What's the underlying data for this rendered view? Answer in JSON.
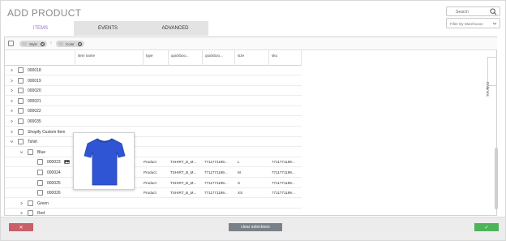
{
  "title": "ADD PRODUCT",
  "tabs": [
    {
      "label": "ITEMS",
      "active": true
    },
    {
      "label": "EVENTS",
      "active": false
    },
    {
      "label": "ADVANCED",
      "active": false
    }
  ],
  "search": {
    "placeholder": "Search",
    "icon": "search-icon"
  },
  "filter": {
    "placeholder": "Filter By Warehouse",
    "icon": "chevron-down-icon"
  },
  "group_by": [
    {
      "label": "Style"
    },
    {
      "label": "Color"
    }
  ],
  "columns_panel_label": "Columns",
  "columns": [
    "",
    "item name",
    "type",
    "quickboo...",
    "quickboo...",
    "size",
    "sku"
  ],
  "tree_rows": [
    {
      "label": "000018",
      "level": 0,
      "arrow": "right"
    },
    {
      "label": "000019",
      "level": 0,
      "arrow": "right"
    },
    {
      "label": "000020",
      "level": 0,
      "arrow": "right"
    },
    {
      "label": "000021",
      "level": 0,
      "arrow": "right"
    },
    {
      "label": "000022",
      "level": 0,
      "arrow": "right"
    },
    {
      "label": "000035",
      "level": 0,
      "arrow": "right"
    },
    {
      "label": "Shopify Custom Item",
      "level": 0,
      "arrow": "right"
    },
    {
      "label": "Tshirt",
      "level": 0,
      "arrow": "down"
    },
    {
      "label": "Blue",
      "level": 1,
      "arrow": "down"
    },
    {
      "label": "000023",
      "level": 2,
      "arrow": "",
      "image": true,
      "type": "Product",
      "qb1": "TSHIRT_B_M...",
      "qb2": "7711771199...",
      "size": "L",
      "sku": "7711771199..."
    },
    {
      "label": "000024",
      "level": 2,
      "arrow": "",
      "type": "Product",
      "qb1": "TSHIRT_B_M...",
      "qb2": "7711771199...",
      "size": "M",
      "sku": "7711771199..."
    },
    {
      "label": "000025",
      "level": 2,
      "arrow": "",
      "type": "Product",
      "qb1": "TSHIRT_B_M...",
      "qb2": "7711771199...",
      "size": "S",
      "sku": "7711771199..."
    },
    {
      "label": "000026",
      "level": 2,
      "arrow": "",
      "type": "Product",
      "qb1": "TSHIRT_B_M...",
      "qb2": "7711771199...",
      "size": "XS",
      "sku": "7711771199..."
    },
    {
      "label": "Green",
      "level": 1,
      "arrow": "right"
    },
    {
      "label": "Red",
      "level": 1,
      "arrow": "right"
    }
  ],
  "preview_image": {
    "icon": "tshirt-image",
    "color": "#2f55d4"
  },
  "footer": {
    "cancel_label": "✕",
    "clear_label": "clear selections",
    "ok_label": "✓"
  },
  "colors": {
    "accent": "#9b6fc7",
    "cancel": "#c8606a",
    "ok": "#4fb35a",
    "clear": "#7a8088"
  }
}
